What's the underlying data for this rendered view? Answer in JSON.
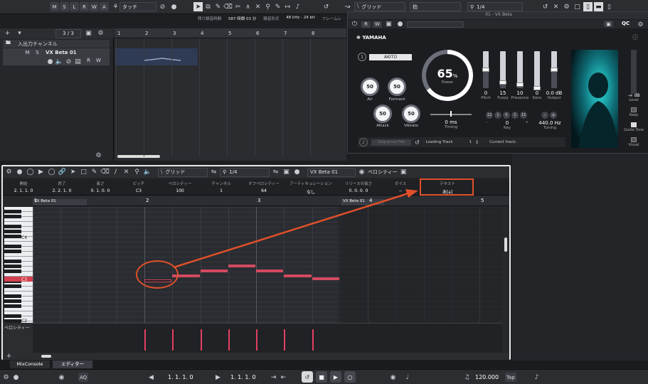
{
  "toolbar": {
    "modes": [
      "M",
      "S",
      "L",
      "R",
      "W",
      "A"
    ],
    "automation_mode": "タッチ",
    "grid_label": "グリッド",
    "snap_label": "拍",
    "quantize": "1/4"
  },
  "status": {
    "rec_time_label": "残り録音時間",
    "rec_time_value": "587 時間 03 分",
    "rec_format_label": "録音形式",
    "rec_format_value": "48 kHz - 24 bit",
    "frame_label": "フレームレ"
  },
  "track_panel": {
    "counter": "3 / 3",
    "io_channel": "入出力チャンネル",
    "track_name": "VX Beta 01",
    "track_buttons": [
      "M",
      "S"
    ],
    "rw": [
      "R",
      "W"
    ]
  },
  "arrange_ruler": [
    "1",
    "2",
    "3",
    "4",
    "5",
    "6",
    "7",
    "8"
  ],
  "plugin": {
    "window_title": "01 - VX Beta",
    "brand": "YAMAHA",
    "qc_label": "QC",
    "voice_index": "1",
    "voice_name": "AKITO",
    "power_value": "65",
    "power_unit": "%",
    "power_label": "Power",
    "knobs": [
      {
        "value": "50",
        "label": "Air"
      },
      {
        "value": "50",
        "label": "Formant"
      },
      {
        "value": "50",
        "label": "Attack"
      },
      {
        "value": "50",
        "label": "Vibrato"
      }
    ],
    "timing_value": "0 ms",
    "timing_label": "Timing",
    "sliders": [
      {
        "value": "0",
        "label": "Pitch",
        "level": 0.5
      },
      {
        "value": "15",
        "label": "Fuzzy",
        "level": 0.15
      },
      {
        "value": "10",
        "label": "Presence",
        "level": 0.1
      },
      {
        "value": "0",
        "label": "Kero",
        "level": 0.0
      },
      {
        "value": "0.0 dB",
        "label": "Output",
        "level": 0.5
      }
    ],
    "key_buttons": [
      "12",
      "1",
      "0",
      "1",
      "12"
    ],
    "key_value": "0",
    "key_label": "Key",
    "tuning_value": "440.0 Hz",
    "tuning_label": "Tuning",
    "level_value": "-∞ dB",
    "level_label": "Level",
    "keep_label": "Keep",
    "guide_tone_label": "Guide Tone",
    "visual_label": "Visual",
    "seq_index": "2",
    "seq_label": "Sequence File",
    "loading_label": "Loading Track",
    "loading_value": "1",
    "current_label": "Current track:"
  },
  "editor": {
    "grid_label": "グリッド",
    "quantize": "1/4",
    "track_select": "VX Beta 01",
    "velocity_menu": "ベロシティー",
    "info_headers": [
      "開始",
      "終了",
      "長さ",
      "ピッチ",
      "ベロシティー",
      "チャンネル",
      "オフベロシティー",
      "アーティキュレーション",
      "リリースの長さ",
      "ボイス",
      "テキスト"
    ],
    "info_values": [
      "2. 1. 1.  0",
      "2. 2. 1.  0",
      "0. 1. 0.  0",
      "C3",
      "100",
      "1",
      "64",
      "なし",
      "0. 0. 0.  0",
      "--",
      "あ[a]"
    ],
    "ruler": [
      "1",
      "2",
      "3",
      "4",
      "5"
    ],
    "part_label": "VX Beta 01",
    "part_label2": "VX Beta 01",
    "key_labels": [
      "C4",
      "C3",
      "C2"
    ],
    "velocity_lane_label": "ベロシティー",
    "note_values": [
      {
        "start": 2.0,
        "pitch": "C3",
        "velocity": 100
      },
      {
        "start": 2.25,
        "pitch": "D3",
        "velocity": 100
      },
      {
        "start": 2.5,
        "pitch": "E3",
        "velocity": 100
      },
      {
        "start": 2.75,
        "pitch": "F3",
        "velocity": 100
      },
      {
        "start": 3.0,
        "pitch": "E3",
        "velocity": 100
      },
      {
        "start": 3.25,
        "pitch": "D3",
        "velocity": 100
      },
      {
        "start": 3.5,
        "pitch": "C#3",
        "velocity": 100
      }
    ]
  },
  "tabs": [
    "MixConsole",
    "エディター"
  ],
  "transport": {
    "left_locator": "1. 1. 1.  0",
    "right_locator": "1. 1. 1.  0",
    "tempo": "120.000",
    "tap": "Tap",
    "aq": "AQ"
  },
  "colors": {
    "accent": "#e0502a",
    "note": "#d24a60",
    "plugin_bg": "#1c1d21"
  }
}
